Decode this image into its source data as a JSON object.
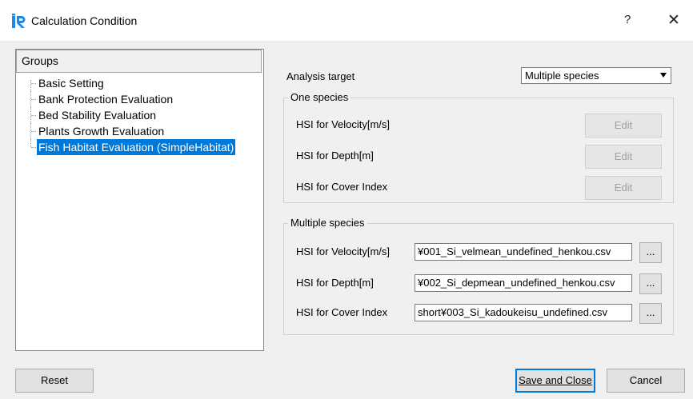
{
  "window": {
    "title": "Calculation Condition",
    "help_symbol": "?",
    "close_symbol": "✕",
    "icon": "iric-app-icon"
  },
  "groups": {
    "header": "Groups",
    "items": [
      {
        "label": "Basic Setting",
        "selected": false
      },
      {
        "label": "Bank Protection Evaluation",
        "selected": false
      },
      {
        "label": "Bed Stability Evaluation",
        "selected": false
      },
      {
        "label": "Plants Growth Evaluation",
        "selected": false
      },
      {
        "label": "Fish Habitat Evaluation (SimpleHabitat)",
        "selected": true
      }
    ]
  },
  "analysis_target": {
    "label": "Analysis target",
    "selected": "Multiple species"
  },
  "one_species": {
    "title": "One species",
    "rows": [
      {
        "label": "HSI for Velocity[m/s]",
        "button": "Edit"
      },
      {
        "label": "HSI for Depth[m]",
        "button": "Edit"
      },
      {
        "label": "HSI for Cover Index",
        "button": "Edit"
      }
    ]
  },
  "multiple_species": {
    "title": "Multiple species",
    "rows": [
      {
        "label": "HSI for Velocity[m/s]",
        "value": "¥001_Si_velmean_undefined_henkou.csv",
        "button": "..."
      },
      {
        "label": "HSI for Depth[m]",
        "value": "¥002_Si_depmean_undefined_henkou.csv",
        "button": "..."
      },
      {
        "label": "HSI for Cover Index",
        "value": "short¥003_Si_kadoukeisu_undefined.csv",
        "button": "..."
      }
    ]
  },
  "footer": {
    "reset": "Reset",
    "save_and_close": "Save and Close",
    "cancel": "Cancel"
  },
  "colors": {
    "selection": "#0078d7",
    "background": "#f0f0f0"
  }
}
